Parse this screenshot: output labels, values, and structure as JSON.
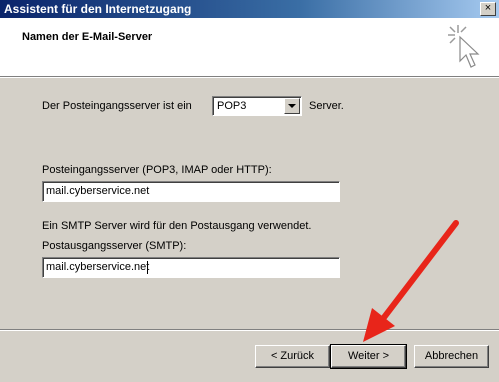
{
  "window": {
    "title": "Assistent für den Internetzugang",
    "close_glyph": "×"
  },
  "header": {
    "title": "Namen der E-Mail-Server",
    "icon": "wizard-cursor-icon"
  },
  "form": {
    "incoming_type_label": "Der Posteingangsserver ist ein",
    "incoming_type_value": "POP3",
    "incoming_type_suffix": "Server.",
    "incoming_server_label": "Posteingangsserver (POP3, IMAP oder HTTP):",
    "incoming_server_value": "mail.cyberservice.net",
    "smtp_note": "Ein SMTP Server wird für den Postausgang verwendet.",
    "outgoing_server_label": "Postausgangsserver (SMTP):",
    "outgoing_server_value": "mail.cyberservice.net"
  },
  "buttons": {
    "back": "< Zurück",
    "next": "Weiter >",
    "cancel": "Abbrechen"
  },
  "annotation": {
    "arrow_color": "#e8251a"
  }
}
